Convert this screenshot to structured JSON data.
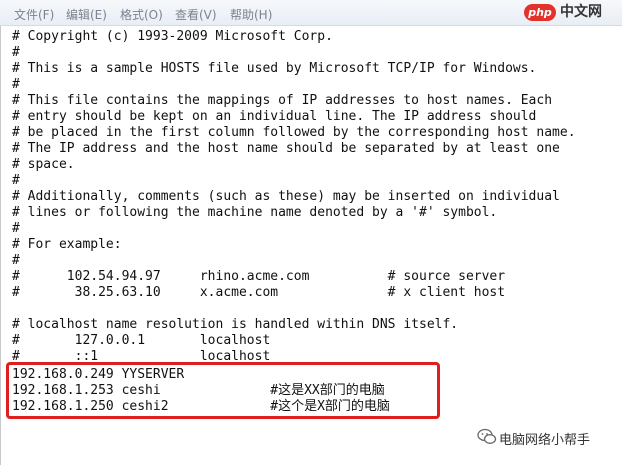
{
  "menu": [
    "文件(F)",
    "编辑(E)",
    "格式(O)",
    "查看(V)",
    "帮助(H)"
  ],
  "watermark": {
    "logo": "php",
    "site": "中文网"
  },
  "lines": [
    "# Copyright (c) 1993-2009 Microsoft Corp.",
    "#",
    "# This is a sample HOSTS file used by Microsoft TCP/IP for Windows.",
    "#",
    "# This file contains the mappings of IP addresses to host names. Each",
    "# entry should be kept on an individual line. The IP address should",
    "# be placed in the first column followed by the corresponding host name.",
    "# The IP address and the host name should be separated by at least one",
    "# space.",
    "#",
    "# Additionally, comments (such as these) may be inserted on individual",
    "# lines or following the machine name denoted by a '#' symbol.",
    "#",
    "# For example:",
    "#",
    "#      102.54.94.97     rhino.acme.com          # source server",
    "#       38.25.63.10     x.acme.com              # x client host",
    "",
    "# localhost name resolution is handled within DNS itself.",
    "#       127.0.0.1       localhost",
    "#       ::1             localhost",
    "192.168.0.249 YYSERVER",
    "192.168.1.253 ceshi              #这是XX部门的电脑",
    "192.168.1.250 ceshi2             #这个是X部门的电脑"
  ],
  "footer": {
    "brand": "电脑网络小帮手"
  }
}
